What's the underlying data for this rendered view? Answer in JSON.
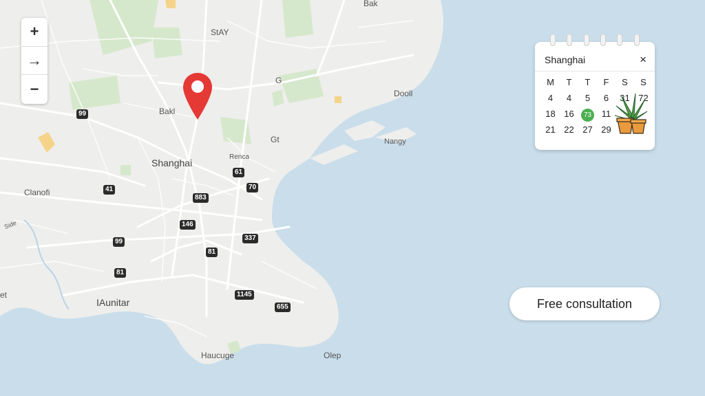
{
  "map": {
    "labels": {
      "bak_top": "Bak",
      "stay": "StAY",
      "g": "G",
      "bakl": "Bakl",
      "dooll": "Dooll",
      "gt": "Gt",
      "nangy": "Nangy",
      "shanghai": "Shanghai",
      "renca": "Renca",
      "clanofi": "Clanofi",
      "aunitar": "IAunitar",
      "et": "et",
      "haucuge": "Haucuge",
      "olep": "Olep",
      "side": "Side"
    },
    "shields": [
      "99",
      "61",
      "41",
      "70",
      "883",
      "146",
      "99",
      "337",
      "81",
      "81",
      "1145",
      "655"
    ]
  },
  "zoom": {
    "in_label": "+",
    "pan_label": "→",
    "out_label": "−"
  },
  "calendar": {
    "title": "Shanghai",
    "close_label": "×",
    "days": [
      [
        "M",
        "T",
        "T",
        "F",
        "S",
        "S"
      ],
      [
        "4",
        "4",
        "5",
        "6",
        "31",
        "72"
      ],
      [
        "18",
        "16",
        "73",
        "11",
        "",
        ""
      ],
      [
        "21",
        "22",
        "27",
        "29",
        "",
        ""
      ]
    ],
    "today_label": "73",
    "today_color": "#4caf50"
  },
  "cta": {
    "label": "Free consultation"
  },
  "colors": {
    "water": "#c9deea",
    "land": "#eeeeec",
    "park": "#d6e8cc",
    "pin": "#e53935",
    "road": "#ffffff"
  }
}
